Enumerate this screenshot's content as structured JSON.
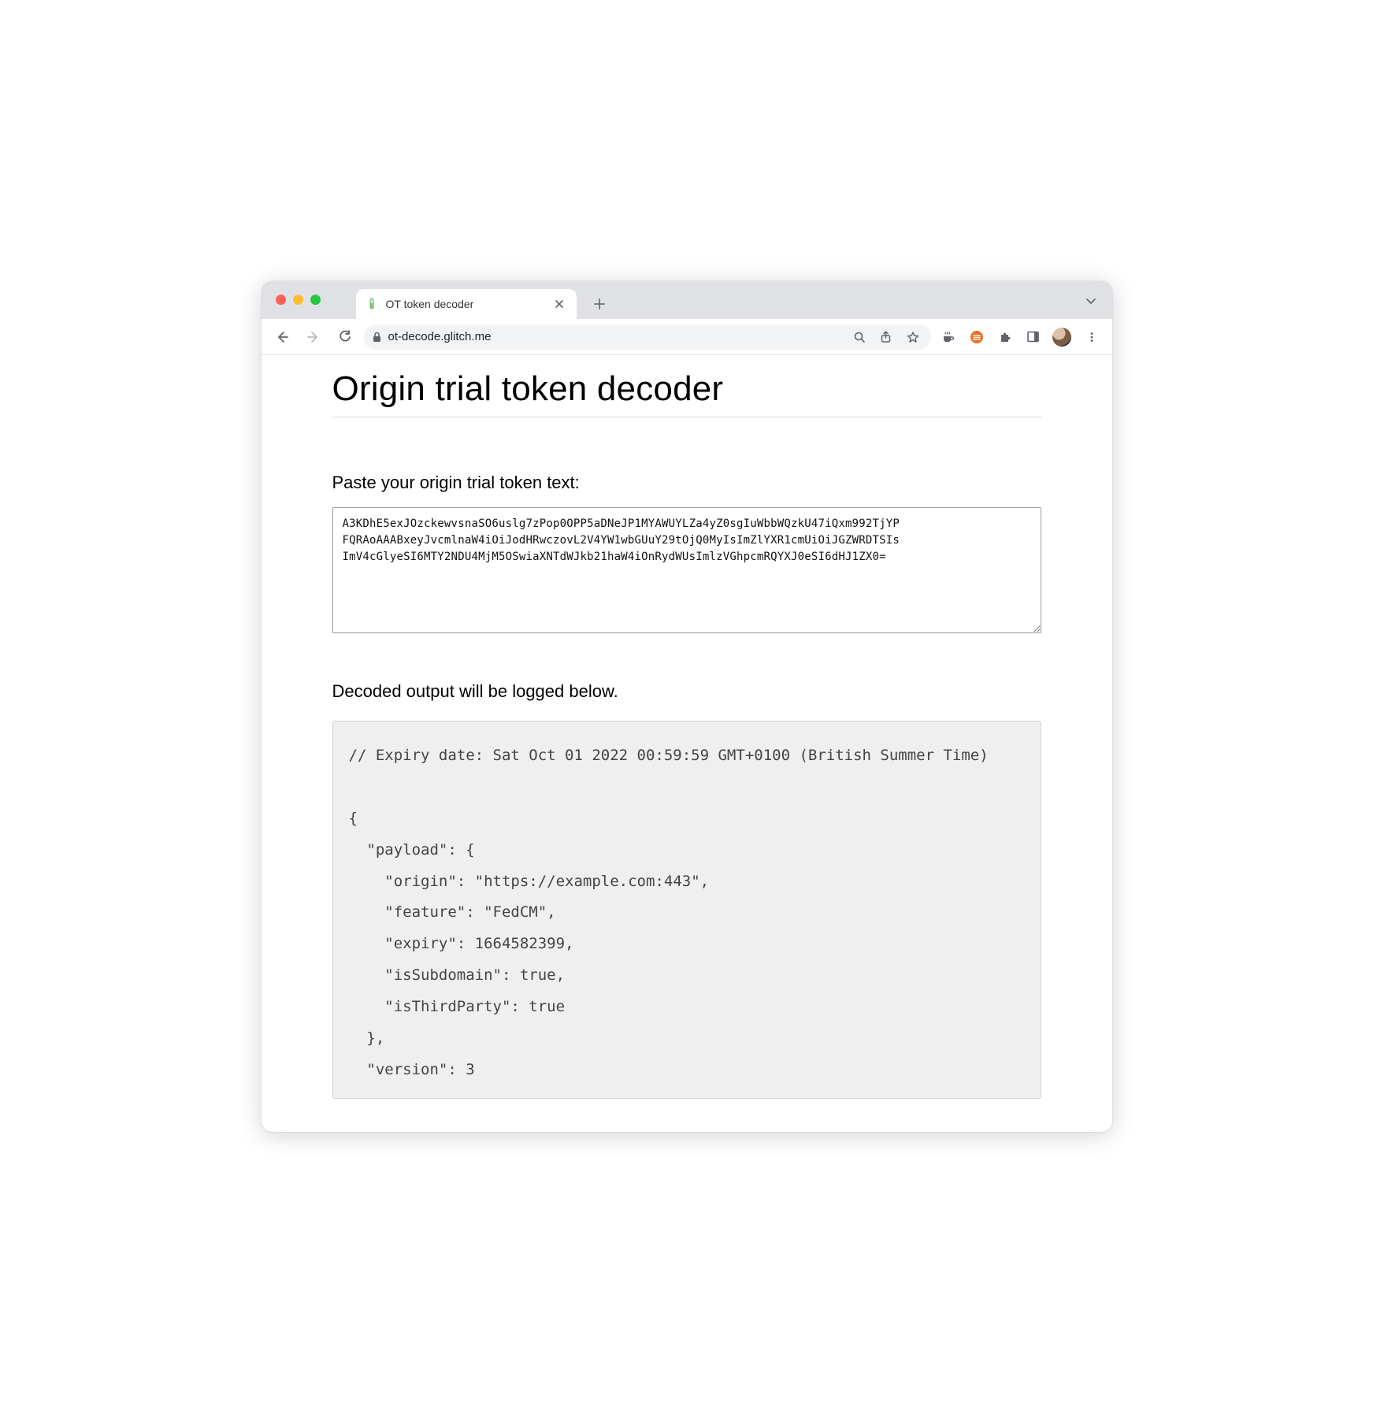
{
  "browser": {
    "tab": {
      "title": "OT token decoder",
      "favicon": "test-tube-icon"
    },
    "url": "ot-decode.glitch.me"
  },
  "page": {
    "title": "Origin trial token decoder",
    "paste_label": "Paste your origin trial token text:",
    "token_text": "A3KDhE5exJOzckewvsnaSO6uslg7zPop0OPP5aDNeJP1MYAWUYLZa4yZ0sgIuWbbWQzkU47iQxm992TjYP\nFQRAoAAABxeyJvcmlnaW4iOiJodHRwczovL2V4YW1wbGUuY29tOjQ0MyIsImZlYXR1cmUiOiJGZWRDTSIs\nImV4cGlyeSI6MTY2NDU4MjM5OSwiaXNTdWJkb21haW4iOnRydWUsImlzVGhpcmRQYXJ0eSI6dHJ1ZX0=",
    "output_label": "Decoded output will be logged below.",
    "output_text": "// Expiry date: Sat Oct 01 2022 00:59:59 GMT+0100 (British Summer Time)\n\n{\n  \"payload\": {\n    \"origin\": \"https://example.com:443\",\n    \"feature\": \"FedCM\",\n    \"expiry\": 1664582399,\n    \"isSubdomain\": true,\n    \"isThirdParty\": true\n  },\n  \"version\": 3"
  }
}
